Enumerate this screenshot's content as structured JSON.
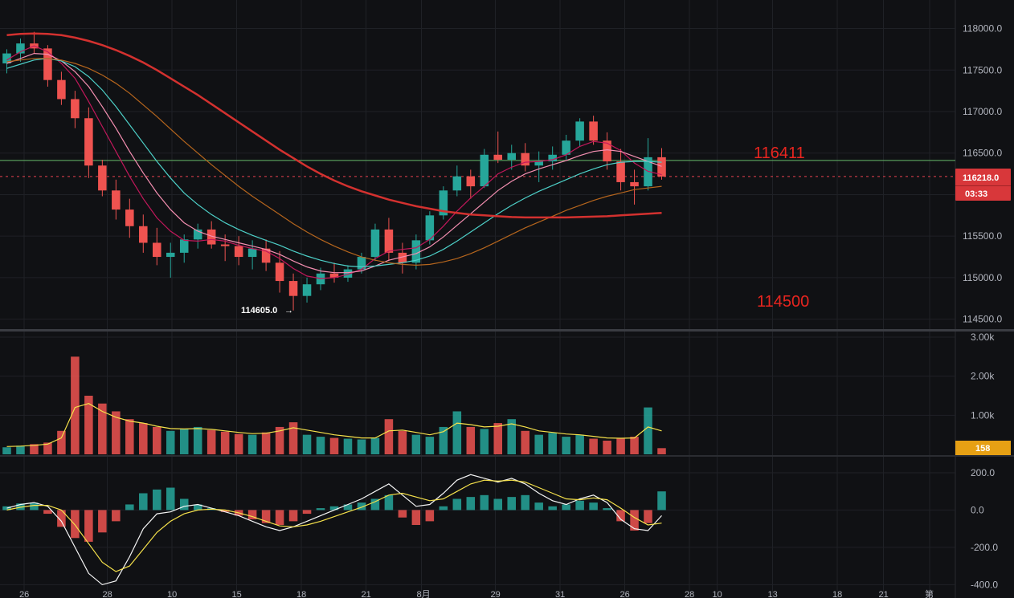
{
  "chart_data": {
    "type": "candlestick",
    "panes": {
      "price": {
        "ylim": [
          114400,
          118150
        ],
        "ticks": [
          "118000.0",
          "117500.0",
          "117000.0",
          "116500.0",
          "116000.0",
          "115500.0",
          "115000.0",
          "114500.0"
        ],
        "current_price": "116218.0",
        "countdown": "03:33",
        "low_label": "114605.0",
        "annotations": [
          {
            "text": "116411",
            "price": 116411
          },
          {
            "text": "114500",
            "price": 114500
          }
        ],
        "hline": 116411,
        "close_dashed": 116218,
        "ohlc": [
          [
            117580,
            117750,
            117460,
            117700
          ],
          [
            117700,
            117880,
            117600,
            117820
          ],
          [
            117820,
            117960,
            117700,
            117760
          ],
          [
            117760,
            117800,
            117300,
            117380
          ],
          [
            117380,
            117480,
            117080,
            117150
          ],
          [
            117150,
            117250,
            116800,
            116920
          ],
          [
            116920,
            117050,
            116200,
            116350
          ],
          [
            116350,
            116420,
            115980,
            116050
          ],
          [
            116050,
            116180,
            115700,
            115820
          ],
          [
            115820,
            115950,
            115480,
            115620
          ],
          [
            115620,
            115760,
            115300,
            115420
          ],
          [
            115420,
            115600,
            115150,
            115250
          ],
          [
            115250,
            115420,
            115000,
            115300
          ],
          [
            115300,
            115520,
            115180,
            115460
          ],
          [
            115460,
            115650,
            115350,
            115580
          ],
          [
            115580,
            115680,
            115350,
            115400
          ],
          [
            115400,
            115520,
            115200,
            115380
          ],
          [
            115380,
            115500,
            115150,
            115250
          ],
          [
            115250,
            115450,
            115100,
            115350
          ],
          [
            115350,
            115460,
            115080,
            115180
          ],
          [
            115180,
            115320,
            114820,
            114960
          ],
          [
            114960,
            115050,
            114605,
            114780
          ],
          [
            114780,
            115000,
            114700,
            114920
          ],
          [
            114920,
            115120,
            114850,
            115050
          ],
          [
            115050,
            115180,
            114940,
            115000
          ],
          [
            115000,
            115150,
            114950,
            115100
          ],
          [
            115100,
            115300,
            115050,
            115250
          ],
          [
            115250,
            115650,
            115200,
            115580
          ],
          [
            115580,
            115720,
            115200,
            115300
          ],
          [
            115300,
            115420,
            115050,
            115180
          ],
          [
            115180,
            115520,
            115100,
            115450
          ],
          [
            115450,
            115800,
            115400,
            115750
          ],
          [
            115750,
            116100,
            115700,
            116050
          ],
          [
            116050,
            116350,
            115980,
            116220
          ],
          [
            116220,
            116300,
            115950,
            116100
          ],
          [
            116100,
            116550,
            116080,
            116480
          ],
          [
            116480,
            116760,
            116380,
            116420
          ],
          [
            116420,
            116600,
            116300,
            116500
          ],
          [
            116500,
            116620,
            116280,
            116350
          ],
          [
            116350,
            116520,
            116150,
            116400
          ],
          [
            116400,
            116580,
            116300,
            116480
          ],
          [
            116480,
            116720,
            116420,
            116650
          ],
          [
            116650,
            116920,
            116580,
            116880
          ],
          [
            116880,
            116950,
            116600,
            116650
          ],
          [
            116650,
            116750,
            116300,
            116400
          ],
          [
            116400,
            116550,
            116050,
            116150
          ],
          [
            116150,
            116300,
            115880,
            116100
          ],
          [
            116100,
            116680,
            116050,
            116450
          ],
          [
            116450,
            116560,
            116180,
            116218
          ]
        ],
        "ma": [
          {
            "name": "",
            "color": "#c2185b",
            "values": [
              117620,
              117720,
              117790,
              117720,
              117580,
              117400,
              117120,
              116820,
              116520,
              116220,
              115950,
              115720,
              115560,
              115450,
              115440,
              115460,
              115440,
              115390,
              115350,
              115320,
              115230,
              115110,
              115020,
              114990,
              115000,
              115040,
              115100,
              115230,
              115320,
              115340,
              115360,
              115460,
              115620,
              115800,
              115960,
              116100,
              116250,
              116330,
              116390,
              116400,
              116420,
              116480,
              116580,
              116640,
              116620,
              116530,
              116380,
              116280,
              116240
            ]
          },
          {
            "name": "",
            "color": "#f48fb1",
            "values": [
              117580,
              117640,
              117700,
              117690,
              117610,
              117480,
              117300,
              117060,
              116800,
              116520,
              116260,
              116020,
              115820,
              115660,
              115560,
              115500,
              115460,
              115420,
              115380,
              115340,
              115280,
              115200,
              115130,
              115080,
              115060,
              115060,
              115080,
              115140,
              115210,
              115250,
              115290,
              115370,
              115490,
              115630,
              115770,
              115910,
              116050,
              116160,
              116250,
              116310,
              116360,
              116410,
              116470,
              116520,
              116540,
              116520,
              116460,
              116400,
              116340
            ]
          },
          {
            "name": "",
            "color": "#4dd0c8",
            "values": [
              117520,
              117570,
              117620,
              117640,
              117610,
              117540,
              117420,
              117260,
              117060,
              116840,
              116620,
              116400,
              116200,
              116020,
              115880,
              115760,
              115660,
              115580,
              115510,
              115450,
              115390,
              115320,
              115260,
              115210,
              115170,
              115140,
              115130,
              115140,
              115160,
              115180,
              115210,
              115260,
              115340,
              115440,
              115550,
              115660,
              115770,
              115870,
              115960,
              116040,
              116110,
              116180,
              116250,
              116310,
              116360,
              116390,
              116400,
              116400,
              116390
            ]
          },
          {
            "name": "",
            "color": "#b5651d",
            "values": [
              117600,
              117620,
              117640,
              117640,
              117620,
              117580,
              117520,
              117440,
              117340,
              117220,
              117080,
              116940,
              116790,
              116640,
              116500,
              116360,
              116230,
              116100,
              115980,
              115870,
              115760,
              115650,
              115550,
              115460,
              115380,
              115310,
              115250,
              115210,
              115180,
              115160,
              115150,
              115160,
              115190,
              115230,
              115290,
              115360,
              115440,
              115520,
              115600,
              115670,
              115740,
              115810,
              115870,
              115930,
              115980,
              116020,
              116060,
              116080,
              116100
            ]
          },
          {
            "name": "",
            "color": "#d3312f",
            "values": [
              117920,
              117935,
              117940,
              117935,
              117920,
              117890,
              117850,
              117800,
              117740,
              117670,
              117590,
              117500,
              117400,
              117300,
              117200,
              117090,
              116980,
              116870,
              116760,
              116650,
              116540,
              116440,
              116340,
              116250,
              116170,
              116100,
              116040,
              115990,
              115940,
              115900,
              115860,
              115830,
              115800,
              115780,
              115760,
              115750,
              115740,
              115730,
              115725,
              115725,
              115725,
              115725,
              115730,
              115735,
              115740,
              115750,
              115760,
              115770,
              115780
            ]
          }
        ]
      },
      "volume": {
        "ticks": [
          "3.00k",
          "2.00k",
          "1.00k"
        ],
        "ylim": [
          0,
          3000
        ],
        "last_value": "158",
        "values": [
          180,
          220,
          260,
          300,
          600,
          2500,
          1500,
          1300,
          1100,
          900,
          800,
          700,
          600,
          650,
          700,
          620,
          580,
          520,
          500,
          560,
          700,
          820,
          500,
          450,
          420,
          400,
          380,
          420,
          900,
          600,
          500,
          450,
          700,
          1100,
          700,
          650,
          800,
          900,
          600,
          500,
          550,
          450,
          500,
          400,
          350,
          400,
          450,
          1200,
          158
        ],
        "ma": [
          200,
          210,
          230,
          260,
          420,
          1200,
          1300,
          1100,
          950,
          850,
          800,
          720,
          660,
          650,
          660,
          640,
          600,
          560,
          530,
          540,
          600,
          680,
          620,
          560,
          500,
          460,
          420,
          420,
          600,
          620,
          560,
          500,
          580,
          800,
          760,
          700,
          720,
          780,
          700,
          600,
          560,
          520,
          500,
          460,
          420,
          410,
          420,
          700,
          600
        ]
      },
      "macd": {
        "ticks": [
          "200.0",
          "0.0",
          "-200.0",
          "-400.0"
        ],
        "ylim": [
          -450,
          260
        ],
        "hist": [
          20,
          35,
          40,
          -20,
          -90,
          -150,
          -170,
          -120,
          -60,
          30,
          90,
          110,
          120,
          60,
          30,
          10,
          -10,
          -30,
          -50,
          -70,
          -80,
          -60,
          -20,
          10,
          20,
          30,
          40,
          60,
          80,
          -40,
          -80,
          -60,
          20,
          60,
          70,
          80,
          60,
          70,
          80,
          40,
          20,
          30,
          50,
          40,
          10,
          -60,
          -110,
          -70,
          100
        ],
        "macd": [
          10,
          30,
          40,
          20,
          -60,
          -200,
          -340,
          -400,
          -380,
          -250,
          -100,
          -20,
          -10,
          20,
          30,
          10,
          -10,
          -30,
          -60,
          -90,
          -110,
          -90,
          -60,
          -30,
          0,
          30,
          60,
          100,
          140,
          80,
          20,
          30,
          90,
          160,
          190,
          170,
          150,
          170,
          140,
          90,
          50,
          30,
          60,
          80,
          40,
          -50,
          -100,
          -110,
          -30
        ],
        "signal": [
          0,
          15,
          25,
          25,
          0,
          -80,
          -180,
          -280,
          -330,
          -300,
          -210,
          -120,
          -60,
          -20,
          0,
          5,
          0,
          -15,
          -35,
          -60,
          -85,
          -90,
          -80,
          -60,
          -35,
          -10,
          15,
          45,
          80,
          90,
          70,
          50,
          60,
          100,
          140,
          160,
          155,
          160,
          150,
          120,
          90,
          60,
          55,
          65,
          55,
          10,
          -40,
          -80,
          -70
        ]
      }
    },
    "x_ticks": [
      "26",
      "28",
      "10",
      "15",
      "18",
      "21",
      "8月",
      "29",
      "31",
      "26",
      "28",
      "10",
      "13",
      "18",
      "21",
      "第"
    ],
    "x_tick_positions": [
      0.0,
      0.09,
      0.16,
      0.23,
      0.3,
      0.37,
      0.43,
      0.51,
      0.58,
      0.65,
      0.72,
      0.75,
      0.81,
      0.88,
      0.93,
      0.98
    ],
    "colors": {
      "background": "#101114",
      "up": "#26a69a",
      "down": "#ef5350",
      "grid": "#1f2126",
      "hline": "#66bb6a",
      "dashed": "#e8414e",
      "tag_red": "#d8373a",
      "tag_orange": "#e6a014",
      "macd_line": "#f5f5f5",
      "signal_line": "#f6e24b",
      "vol_ma": "#f6e24b",
      "vol_ma2": "#ffffff"
    }
  }
}
